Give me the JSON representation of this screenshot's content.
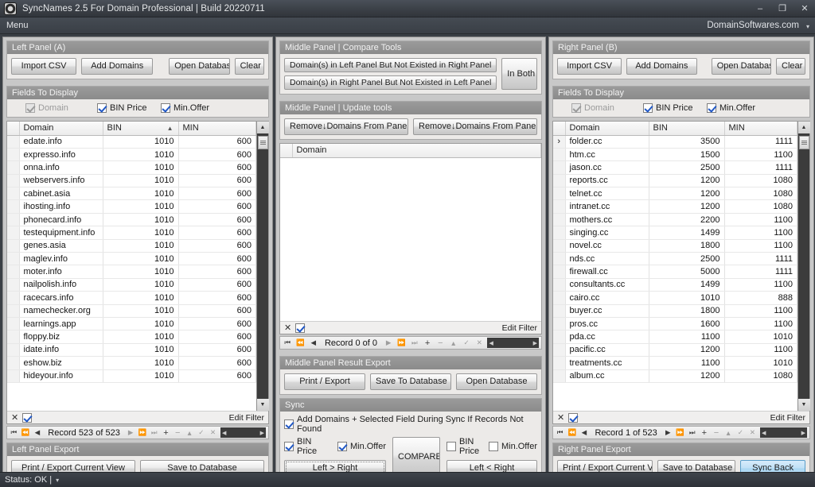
{
  "titlebar": {
    "icon": "camera-aperture-icon",
    "title": "SyncNames 2.5 For Domain Professional   |   Build 20220711",
    "minimize": "–",
    "maximize": "❐",
    "close": "✕"
  },
  "menubar": {
    "menu_label": "Menu",
    "brand": "DomainSoftwares.com",
    "caret": "▾"
  },
  "left_panel": {
    "title": "Left Panel (A)",
    "buttons": {
      "import_csv": "Import CSV",
      "add_domains": "Add Domains",
      "open_database": "Open Database",
      "clear": "Clear"
    },
    "fields_title": "Fields To Display",
    "fields": [
      {
        "label": "Domain",
        "checked": true,
        "disabled": true
      },
      {
        "label": "BIN Price",
        "checked": true,
        "disabled": false
      },
      {
        "label": "Min.Offer",
        "checked": true,
        "disabled": false
      }
    ],
    "columns": [
      "Domain",
      "BIN",
      "MIN"
    ],
    "sort_indicator": "▲",
    "rows": [
      [
        "edate.info",
        "1010",
        "600"
      ],
      [
        "expresso.info",
        "1010",
        "600"
      ],
      [
        "onna.info",
        "1010",
        "600"
      ],
      [
        "webservers.info",
        "1010",
        "600"
      ],
      [
        "cabinet.asia",
        "1010",
        "600"
      ],
      [
        "ihosting.info",
        "1010",
        "600"
      ],
      [
        "phonecard.info",
        "1010",
        "600"
      ],
      [
        "testequipment.info",
        "1010",
        "600"
      ],
      [
        "genes.asia",
        "1010",
        "600"
      ],
      [
        "maglev.info",
        "1010",
        "600"
      ],
      [
        "moter.info",
        "1010",
        "600"
      ],
      [
        "nailpolish.info",
        "1010",
        "600"
      ],
      [
        "racecars.info",
        "1010",
        "600"
      ],
      [
        "namechecker.org",
        "1010",
        "600"
      ],
      [
        "learnings.app",
        "1010",
        "600"
      ],
      [
        "floppy.biz",
        "1010",
        "600"
      ],
      [
        "idate.info",
        "1010",
        "600"
      ],
      [
        "eshow.biz",
        "1010",
        "600"
      ],
      [
        "hideyour.info",
        "1010",
        "600"
      ]
    ],
    "filter": {
      "close": "✕",
      "checked": true,
      "edit_filter": "Edit Filter"
    },
    "navigator": {
      "record_label": "Record 523 of 523"
    },
    "export_title": "Left Panel Export",
    "export_buttons": {
      "print": "Print / Export Current View",
      "save": "Save to Database"
    }
  },
  "middle_panel": {
    "compare_title": "Middle Panel | Compare Tools",
    "compare_buttons": {
      "left_not_right": "Domain(s) in Left Panel But Not Existed in Right Panel",
      "right_not_left": "Domain(s) in Right Panel But Not Existed in Left Panel",
      "in_both": "In Both"
    },
    "update_title": "Middle Panel | Update tools",
    "update_buttons": {
      "remove_a": "Remove↓Domains From Panel A",
      "remove_b": "Remove↓Domains From Panel B"
    },
    "columns": [
      "Domain"
    ],
    "rows": [],
    "filter": {
      "close": "✕",
      "checked": true,
      "edit_filter": "Edit Filter"
    },
    "navigator": {
      "record_label": "Record 0 of 0"
    },
    "export_title": "Middle Panel Result Export",
    "export_buttons": {
      "print": "Print / Export",
      "save": "Save To Database",
      "open": "Open Database"
    },
    "sync_title": "Sync",
    "sync_add_label": "Add Domains + Selected Field During Sync If Records Not Found",
    "sync_add_checked": true,
    "sync_left_fields": [
      {
        "label": "BIN Price",
        "checked": true
      },
      {
        "label": "Min.Offer",
        "checked": true
      }
    ],
    "sync_right_fields": [
      {
        "label": "BIN Price",
        "checked": false
      },
      {
        "label": "Min.Offer",
        "checked": false
      }
    ],
    "sync_buttons": {
      "left_to_right": "Left > Right",
      "compare": "COMPARE",
      "left_from_right": "Left < Right"
    }
  },
  "right_panel": {
    "title": "Right Panel (B)",
    "buttons": {
      "import_csv": "Import CSV",
      "add_domains": "Add Domains",
      "open_database": "Open Database",
      "clear": "Clear"
    },
    "fields_title": "Fields To Display",
    "fields": [
      {
        "label": "Domain",
        "checked": true,
        "disabled": true
      },
      {
        "label": "BIN Price",
        "checked": true,
        "disabled": false
      },
      {
        "label": "Min.Offer",
        "checked": true,
        "disabled": false
      }
    ],
    "columns": [
      "Domain",
      "BIN",
      "MIN"
    ],
    "current_row_marker": "›",
    "rows": [
      [
        "folder.cc",
        "3500",
        "1111"
      ],
      [
        "htm.cc",
        "1500",
        "1100"
      ],
      [
        "jason.cc",
        "2500",
        "1111"
      ],
      [
        "reports.cc",
        "1200",
        "1080"
      ],
      [
        "telnet.cc",
        "1200",
        "1080"
      ],
      [
        "intranet.cc",
        "1200",
        "1080"
      ],
      [
        "mothers.cc",
        "2200",
        "1100"
      ],
      [
        "singing.cc",
        "1499",
        "1100"
      ],
      [
        "novel.cc",
        "1800",
        "1100"
      ],
      [
        "nds.cc",
        "2500",
        "1111"
      ],
      [
        "firewall.cc",
        "5000",
        "1111"
      ],
      [
        "consultants.cc",
        "1499",
        "1100"
      ],
      [
        "cairo.cc",
        "1010",
        "888"
      ],
      [
        "buyer.cc",
        "1800",
        "1100"
      ],
      [
        "pros.cc",
        "1600",
        "1100"
      ],
      [
        "pda.cc",
        "1100",
        "1010"
      ],
      [
        "pacific.cc",
        "1200",
        "1100"
      ],
      [
        "treatments.cc",
        "1100",
        "1010"
      ],
      [
        "album.cc",
        "1200",
        "1080"
      ]
    ],
    "filter": {
      "close": "✕",
      "checked": true,
      "edit_filter": "Edit Filter"
    },
    "navigator": {
      "record_label": "Record 1 of 523"
    },
    "export_title": "Right Panel Export",
    "export_buttons": {
      "print": "Print / Export Current View",
      "save": "Save to Database",
      "sync_back": "Sync Back"
    }
  },
  "statusbar": {
    "text": "Status: OK |",
    "caret": "▾"
  },
  "colors": {
    "window_chrome": "#3a3f45",
    "panel_bg": "#c8c8c8",
    "group_header": "#9b9b9b",
    "accent_button": "#a9d5f2",
    "checkbox_check": "#2158c6"
  }
}
